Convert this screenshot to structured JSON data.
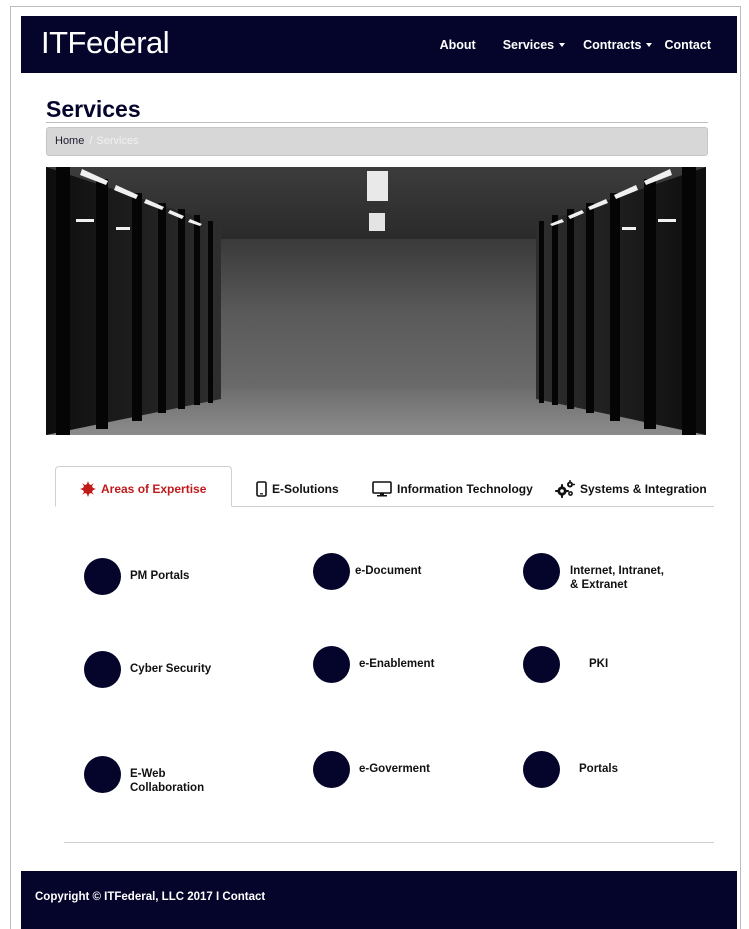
{
  "brand": "ITFederal",
  "nav": {
    "about": "About",
    "services": "Services",
    "contracts": "Contracts",
    "contact": "Contact"
  },
  "page": {
    "title": "Services",
    "breadcrumb": {
      "home": "Home",
      "separator": "/",
      "current": "Services"
    }
  },
  "hero": {
    "description_icon": "server-room-photo"
  },
  "tabs": [
    {
      "label": "Areas of Expertise",
      "icon": "gear-burst-icon",
      "active": true
    },
    {
      "label": "E-Solutions",
      "icon": "tablet-icon",
      "active": false
    },
    {
      "label": "Information Technology",
      "icon": "monitor-icon",
      "active": false
    },
    {
      "label": "Systems & Integration",
      "icon": "gears-icon",
      "active": false
    }
  ],
  "expertise": [
    {
      "label": "PM Portals"
    },
    {
      "label": "e-Document"
    },
    {
      "label": "Internet, Intranet,\n& Extranet"
    },
    {
      "label": "Cyber Security"
    },
    {
      "label": "e-Enablement"
    },
    {
      "label": "PKI"
    },
    {
      "label": "E-Web\nCollaboration"
    },
    {
      "label": "e-Goverment"
    },
    {
      "label": "Portals"
    }
  ],
  "footer": {
    "copyright": "Copyright © ITFederal, LLC 2017 I Contact"
  },
  "colors": {
    "navy": "#05052b",
    "active_tab": "#c01a1a",
    "breadcrumb_bg": "#d7d7d7"
  }
}
